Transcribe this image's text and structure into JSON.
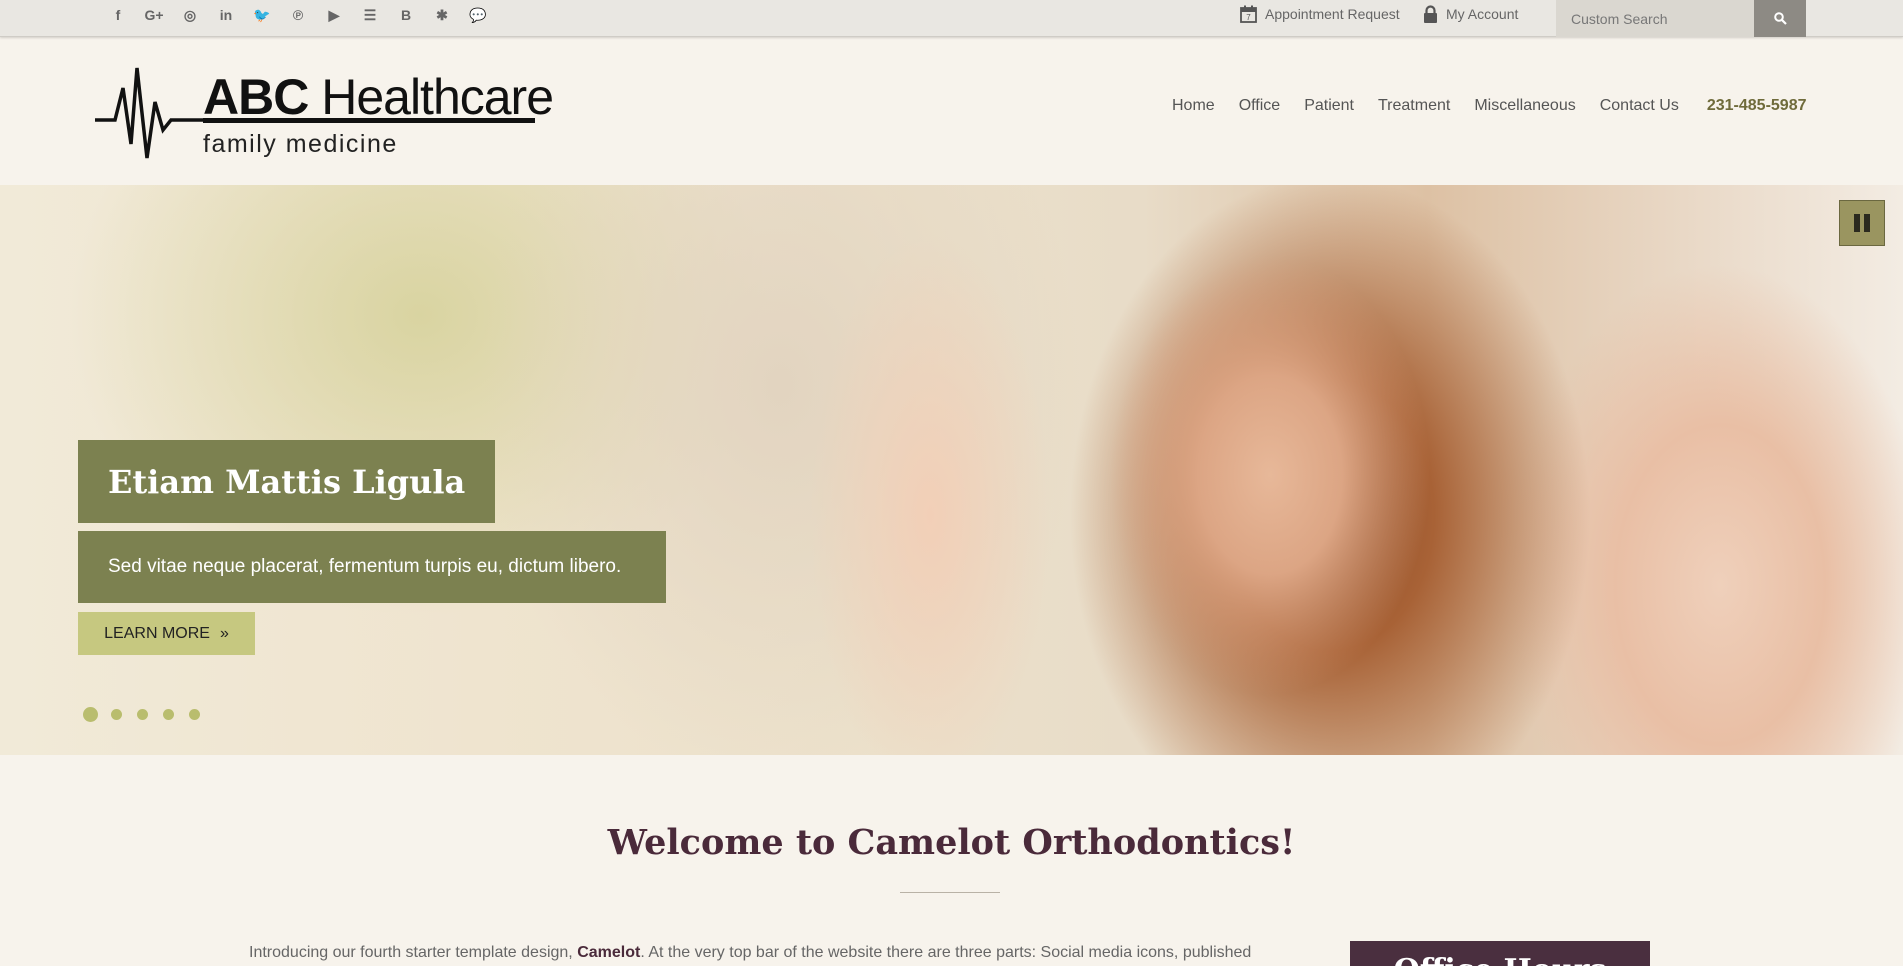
{
  "topbar": {
    "social_icons": [
      {
        "name": "facebook-icon",
        "glyph": "f"
      },
      {
        "name": "google-plus-icon",
        "glyph": "G+"
      },
      {
        "name": "instagram-icon",
        "glyph": "◎"
      },
      {
        "name": "linkedin-icon",
        "glyph": "in"
      },
      {
        "name": "twitter-icon",
        "glyph": "🐦"
      },
      {
        "name": "pinterest-icon",
        "glyph": "℗"
      },
      {
        "name": "youtube-icon",
        "glyph": "▶"
      },
      {
        "name": "rss-icon",
        "glyph": "☰"
      },
      {
        "name": "blogger-icon",
        "glyph": "B"
      },
      {
        "name": "yelp-icon",
        "glyph": "✱"
      },
      {
        "name": "chat-icon",
        "glyph": "💬"
      }
    ],
    "appointment_label": "Appointment Request",
    "account_label": "My Account",
    "search_placeholder": "Custom Search"
  },
  "header": {
    "logo_title_bold": "ABC",
    "logo_title_rest": " Healthcare",
    "logo_subtitle": "family medicine",
    "nav": [
      "Home",
      "Office",
      "Patient",
      "Treatment",
      "Miscellaneous",
      "Contact Us"
    ],
    "phone": "231-485-5987"
  },
  "hero": {
    "title": "Etiam Mattis Ligula",
    "text": "Sed vitae neque placerat, fermentum turpis eu, dictum libero.",
    "button_label": "LEARN MORE",
    "button_arrow": "»",
    "slide_count": 5,
    "active_slide": 1
  },
  "welcome": {
    "title": "Welcome to Camelot Orthodontics!",
    "intro_before": "Introducing our fourth starter template design, ",
    "intro_bold": "Camelot",
    "intro_after": ". At the very top bar of the website there are three parts: Social media icons, published",
    "office_hours_title": "Office Hours"
  },
  "colors": {
    "accent_olive": "#7c8150",
    "button_yellow": "#c6c880",
    "heading_plum": "#4a2a3a",
    "background": "#f7f3ec"
  }
}
